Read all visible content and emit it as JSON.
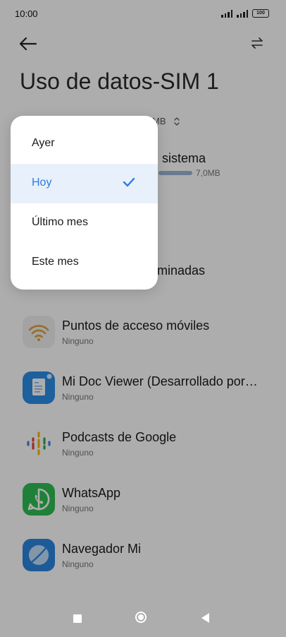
{
  "status_bar": {
    "time": "10:00",
    "battery": "100"
  },
  "header": {
    "title": "Uso de datos-SIM 1"
  },
  "background": {
    "usage_suffix": "MB",
    "system_item": {
      "title_partial": "sistema",
      "size": "7,0MB"
    },
    "partial_item_title": "minadas"
  },
  "apps": [
    {
      "name": "Puntos de acceso móviles",
      "sub": "Ninguno",
      "icon": "wifi-hotspot-icon"
    },
    {
      "name": "Mi Doc Viewer (Desarrollado por…",
      "sub": "Ninguno",
      "icon": "document-viewer-icon"
    },
    {
      "name": "Podcasts de Google",
      "sub": "Ninguno",
      "icon": "google-podcasts-icon"
    },
    {
      "name": "WhatsApp",
      "sub": "Ninguno",
      "icon": "whatsapp-icon"
    },
    {
      "name": "Navegador Mi",
      "sub": "Ninguno",
      "icon": "mi-browser-icon"
    }
  ],
  "dropdown": {
    "items": [
      {
        "label": "Ayer",
        "selected": false
      },
      {
        "label": "Hoy",
        "selected": true
      },
      {
        "label": "Último mes",
        "selected": false
      },
      {
        "label": "Este mes",
        "selected": false
      }
    ]
  },
  "colors": {
    "accent": "#2f7be5",
    "selected_bg": "#e8f0fb",
    "overlay": "rgba(0,0,0,0.32)"
  }
}
